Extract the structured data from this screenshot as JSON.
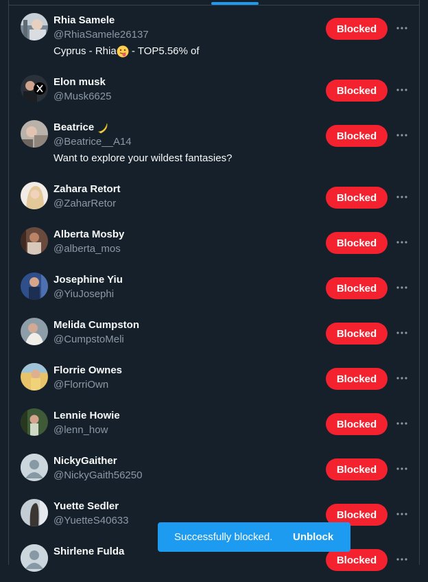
{
  "accent_color": "#1d9bf0",
  "blocked_color": "#f4212e",
  "background_color": "#15202b",
  "users": [
    {
      "name": "Rhia Samele",
      "handle": "@RhiaSamele26137",
      "bio_pre": "Cyprus - Rhia",
      "bio_emoji": "tongue-face-emoji",
      "bio_post": " - TOP5.56% of",
      "button": "Blocked",
      "avatar": "photo-avatar"
    },
    {
      "name": "Elon musk",
      "handle": "@Musk6625",
      "button": "Blocked",
      "avatar": "photo-avatar"
    },
    {
      "name": "Beatrice",
      "name_emoji": "banana-emoji",
      "handle": "@Beatrice__A14",
      "bio": "Want to explore your wildest fantasies?",
      "button": "Blocked",
      "avatar": "photo-avatar"
    },
    {
      "name": "Zahara Retort",
      "handle": "@ZaharRetor",
      "button": "Blocked",
      "avatar": "photo-avatar"
    },
    {
      "name": "Alberta Mosby",
      "handle": "@alberta_mos",
      "button": "Blocked",
      "avatar": "photo-avatar"
    },
    {
      "name": "Josephine Yiu",
      "handle": "@YiuJosephi",
      "button": "Blocked",
      "avatar": "photo-avatar"
    },
    {
      "name": "Melida Cumpston",
      "handle": "@CumpstoMeli",
      "button": "Blocked",
      "avatar": "photo-avatar"
    },
    {
      "name": "Florrie Ownes",
      "handle": "@FlorriOwn",
      "button": "Blocked",
      "avatar": "photo-avatar"
    },
    {
      "name": "Lennie Howie",
      "handle": "@lenn_how",
      "button": "Blocked",
      "avatar": "photo-avatar"
    },
    {
      "name": "NickyGaither",
      "handle": "@NickyGaith56250",
      "button": "Blocked",
      "avatar": "default-avatar"
    },
    {
      "name": "Yuette Sedler",
      "handle": "@YuetteS40633",
      "button": "Blocked",
      "avatar": "photo-avatar"
    },
    {
      "name": "Shirlene Fulda",
      "button": "Blocked",
      "avatar": "default-avatar"
    }
  ],
  "toast": {
    "message": "Successfully blocked.",
    "action": "Unblock"
  }
}
